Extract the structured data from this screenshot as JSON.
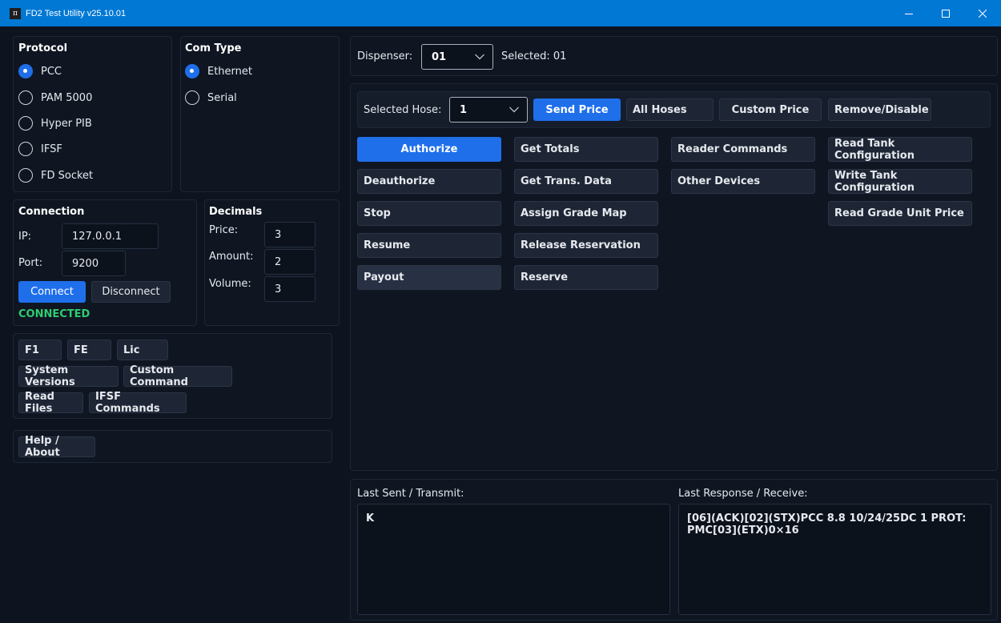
{
  "window": {
    "title": "FD2 Test Utility v25.10.01",
    "icon_glyph": "π"
  },
  "protocol": {
    "heading": "Protocol",
    "options": [
      {
        "label": "PCC",
        "selected": true
      },
      {
        "label": "PAM 5000",
        "selected": false
      },
      {
        "label": "Hyper PIB",
        "selected": false
      },
      {
        "label": "IFSF",
        "selected": false
      },
      {
        "label": "FD Socket",
        "selected": false
      }
    ]
  },
  "com_type": {
    "heading": "Com Type",
    "options": [
      {
        "label": "Ethernet",
        "selected": true
      },
      {
        "label": "Serial",
        "selected": false
      }
    ]
  },
  "connection": {
    "heading": "Connection",
    "ip_label": "IP:",
    "ip_value": "127.0.0.1",
    "port_label": "Port:",
    "port_value": "9200",
    "connect_label": "Connect",
    "disconnect_label": "Disconnect",
    "status": "CONNECTED"
  },
  "decimals": {
    "heading": "Decimals",
    "price_label": "Price:",
    "price_value": "3",
    "amount_label": "Amount:",
    "amount_value": "2",
    "volume_label": "Volume:",
    "volume_value": "3"
  },
  "tools": {
    "f1": "F1",
    "fe": "FE",
    "lic": "Lic",
    "system_versions": "System Versions",
    "custom_command": "Custom Command",
    "read_files": "Read Files",
    "ifsf_commands": "IFSF Commands"
  },
  "help": {
    "label": "Help / About"
  },
  "dispenser": {
    "label": "Dispenser:",
    "value": "01",
    "selected_text": "Selected: 01"
  },
  "hose": {
    "label": "Selected Hose:",
    "value": "1",
    "send_price": "Send Price",
    "all_hoses": "All Hoses",
    "custom_price": "Custom Price",
    "remove_disable": "Remove/Disable"
  },
  "commands": {
    "authorize": "Authorize",
    "deauthorize": "Deauthorize",
    "stop": "Stop",
    "resume": "Resume",
    "payout": "Payout",
    "get_totals": "Get Totals",
    "get_trans_data": "Get Trans. Data",
    "assign_grade_map": "Assign Grade Map",
    "release_reservation": "Release Reservation",
    "reserve": "Reserve",
    "reader_commands": "Reader Commands",
    "other_devices": "Other Devices",
    "read_tank_configuration": "Read Tank Configuration",
    "write_tank_configuration": "Write Tank Configuration",
    "read_grade_unit_price": "Read Grade Unit Price"
  },
  "log": {
    "sent_label": "Last Sent / Transmit:",
    "sent_value": "K",
    "received_label": "Last Response / Receive:",
    "received_value": "[06](ACK)[02](STX)PCC 8.8 10/24/25DC 1 PROT: PMC[03](ETX)0×16"
  },
  "colors": {
    "accent": "#1f6feb",
    "titlebar": "#0078d4",
    "connected": "#2ecc71",
    "background": "#0d1420"
  }
}
